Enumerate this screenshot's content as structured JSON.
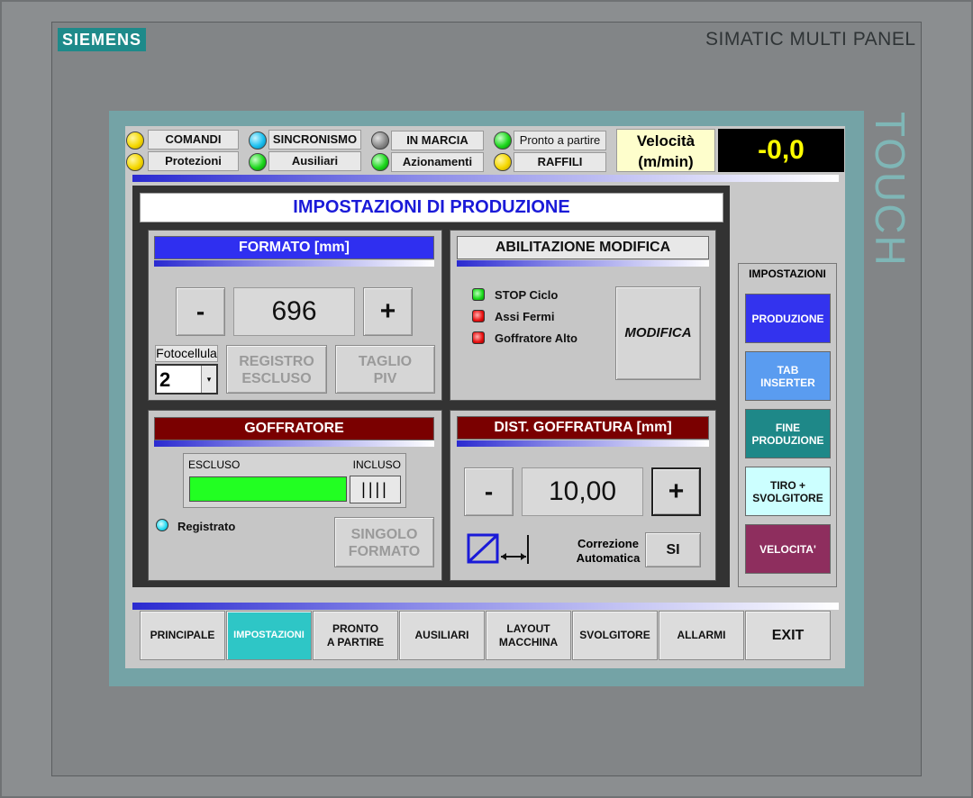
{
  "device": {
    "logo": "SIEMENS",
    "brand": "SIMATIC MULTI PANEL",
    "touch": "TOUCH"
  },
  "status": {
    "row1": [
      "COMANDI",
      "SINCRONISMO",
      "IN MARCIA",
      "Pronto a partire"
    ],
    "row2": [
      "Protezioni",
      "Ausiliari",
      "Azionamenti",
      "RAFFILI"
    ],
    "velocity_label_1": "Velocità",
    "velocity_label_2": "(m/min)",
    "velocity_value": "-0,0"
  },
  "page_title": "IMPOSTAZIONI DI PRODUZIONE",
  "formato": {
    "header": "FORMATO [mm]",
    "minus": "-",
    "value": "696",
    "plus": "+",
    "fotocellula_label": "Fotocellula",
    "fotocellula_value": "2",
    "registro_1": "REGISTRO",
    "registro_2": "ESCLUSO",
    "taglio_1": "TAGLIO",
    "taglio_2": "PIV"
  },
  "abilitazione": {
    "header": "ABILITAZIONE MODIFICA",
    "items": [
      "STOP Ciclo",
      "Assi Fermi",
      "Goffratore Alto"
    ],
    "modifica": "MODIFICA"
  },
  "goffratore": {
    "header": "GOFFRATORE",
    "escluso": "ESCLUSO",
    "incluso": "INCLUSO",
    "registrato": "Registrato",
    "singolo_1": "SINGOLO",
    "singolo_2": "FORMATO"
  },
  "dist": {
    "header": "DIST. GOFFRATURA [mm]",
    "minus": "-",
    "value": "10,00",
    "plus": "+",
    "corr_1": "Correzione",
    "corr_2": "Automatica",
    "si": "SI"
  },
  "side": {
    "title": "IMPOSTAZIONI",
    "buttons": [
      {
        "l1": "PRODUZIONE",
        "l2": ""
      },
      {
        "l1": "TAB",
        "l2": "INSERTER"
      },
      {
        "l1": "FINE",
        "l2": "PRODUZIONE"
      },
      {
        "l1": "TIRO +",
        "l2": "SVOLGITORE"
      },
      {
        "l1": "VELOCITA'",
        "l2": ""
      }
    ]
  },
  "nav": [
    {
      "l1": "PRINCIPALE",
      "l2": ""
    },
    {
      "l1": "IMPOSTAZIONI",
      "l2": ""
    },
    {
      "l1": "PRONTO",
      "l2": "A PARTIRE"
    },
    {
      "l1": "AUSILIARI",
      "l2": ""
    },
    {
      "l1": "LAYOUT",
      "l2": "MACCHINA"
    },
    {
      "l1": "SVOLGITORE",
      "l2": ""
    },
    {
      "l1": "ALLARMI",
      "l2": ""
    },
    {
      "l1": "EXIT",
      "l2": ""
    }
  ],
  "colors": {
    "accent_blue": "#2f2ff0",
    "dark_red": "#7a0000",
    "teal": "#1e8a8a",
    "active_nav": "#2ec6c6"
  }
}
